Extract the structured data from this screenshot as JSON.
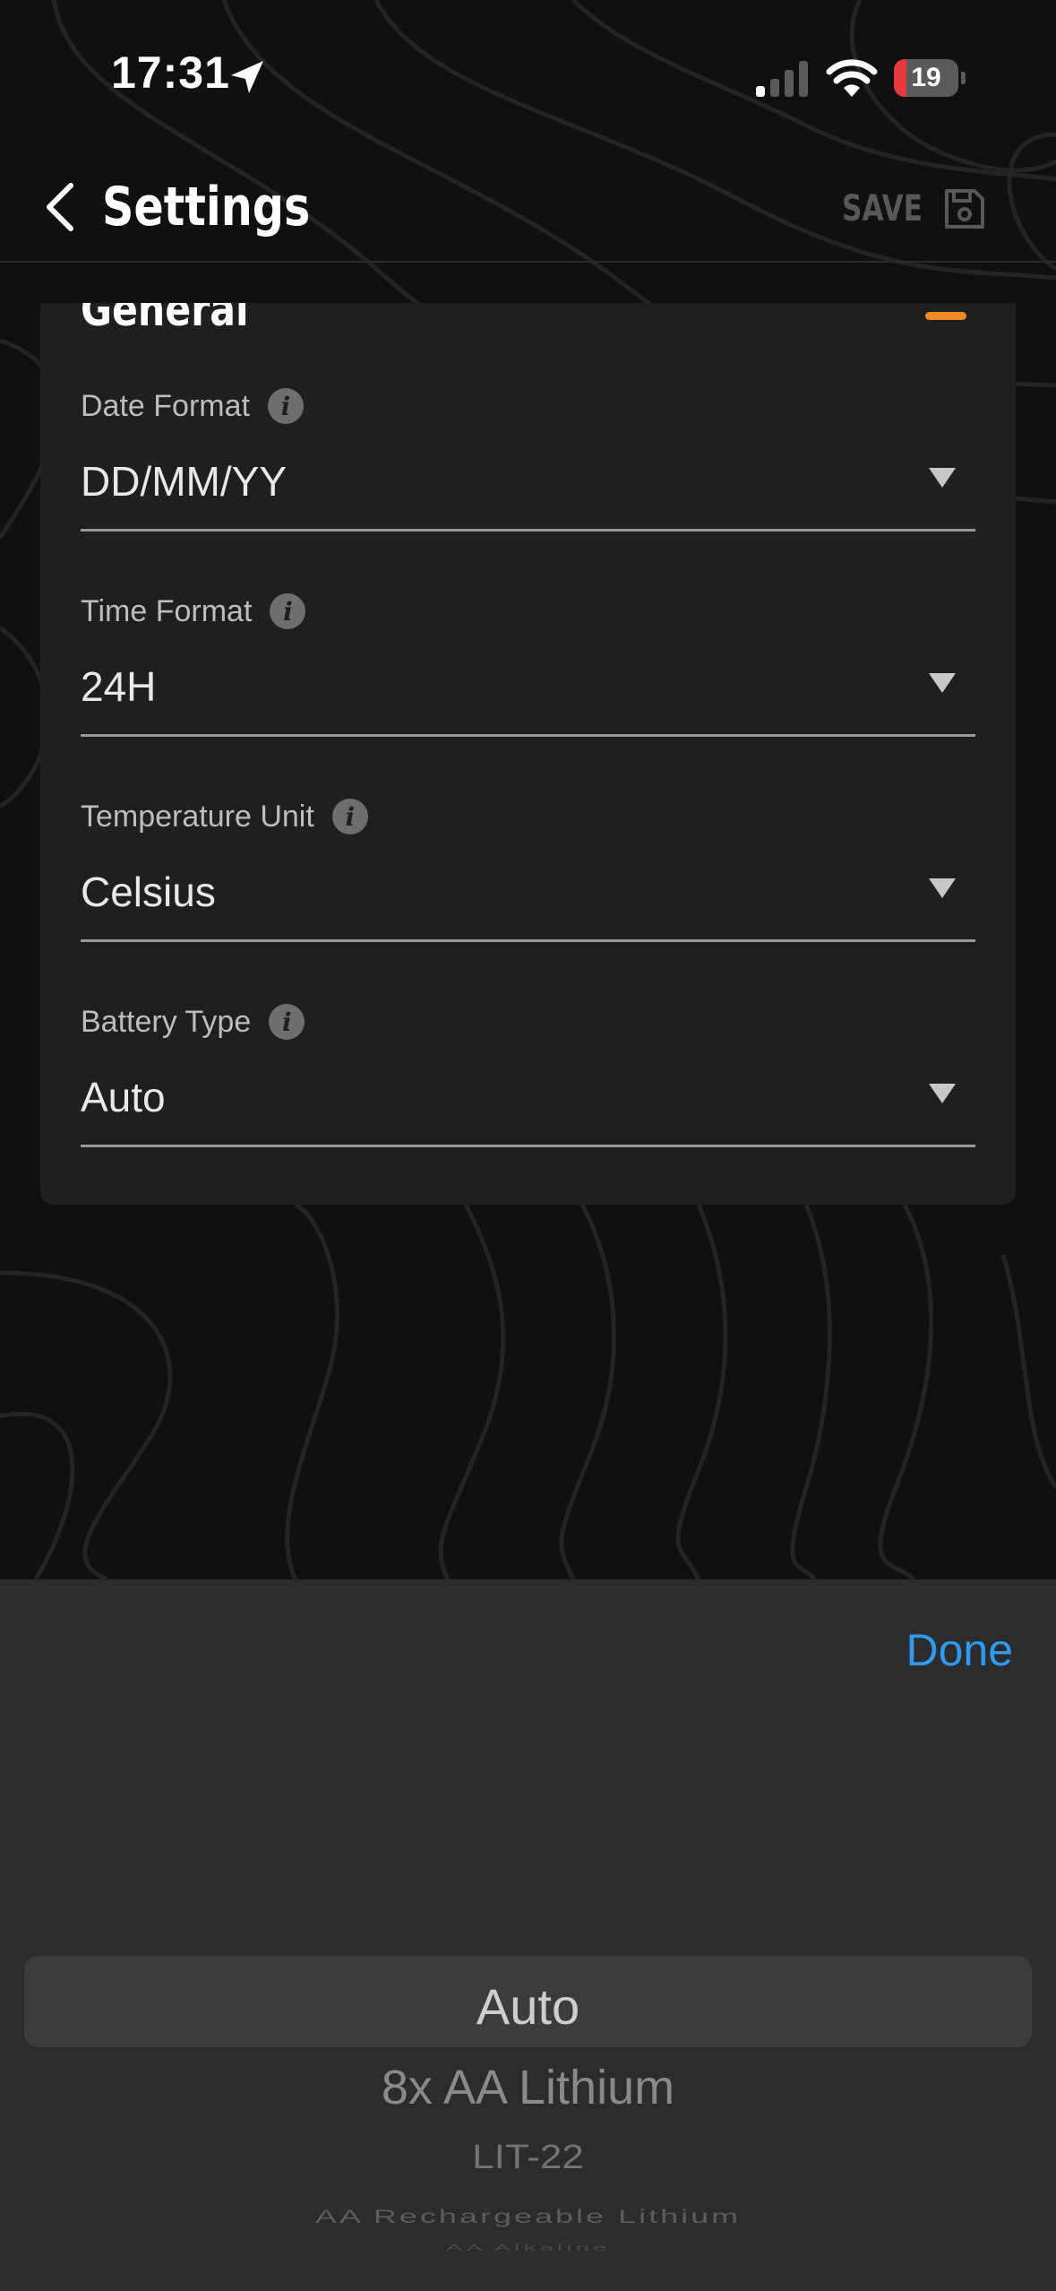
{
  "status_bar": {
    "time": "17:31",
    "battery_level": "19",
    "battery_fraction": 0.19,
    "icons": [
      "location-arrow-icon",
      "cellular-signal-icon",
      "wifi-icon",
      "battery-icon"
    ]
  },
  "header": {
    "title": "Settings",
    "back_icon": "chevron-left-icon",
    "save_label": "SAVE",
    "save_icon": "floppy-disk-icon"
  },
  "section": {
    "title": "General",
    "collapse_color": "#f08a24"
  },
  "fields": [
    {
      "label": "Date Format",
      "value": "DD/MM/YY"
    },
    {
      "label": "Time Format",
      "value": "24H"
    },
    {
      "label": "Temperature Unit",
      "value": "Celsius"
    },
    {
      "label": "Battery Type",
      "value": "Auto"
    }
  ],
  "info_glyph": "i",
  "picker": {
    "done_label": "Done",
    "done_color": "#2f9bf0",
    "options": [
      "Auto",
      "8x AA Lithium",
      "LIT-22",
      "AA Rechargeable Lithium",
      "AA Alkaline"
    ],
    "selected": "Auto"
  }
}
